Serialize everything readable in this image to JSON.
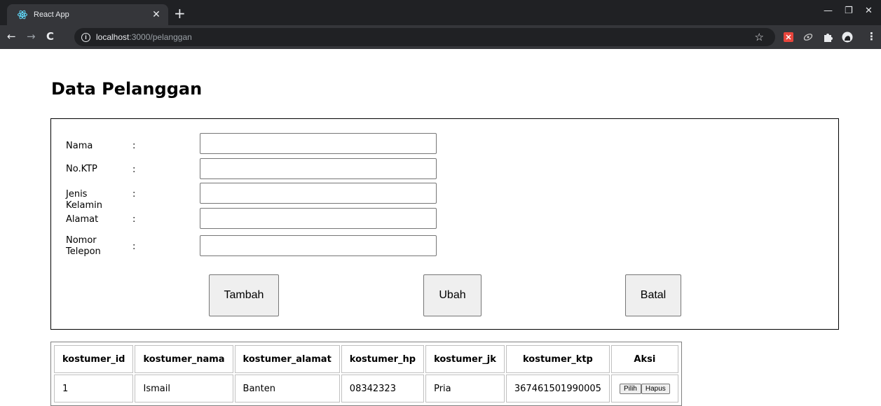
{
  "browser": {
    "tab_title": "React App",
    "url_host": "localhost",
    "url_path": ":3000/pelanggan",
    "icons": {
      "favicon": "react-icon",
      "close": "close-icon",
      "new_tab": "plus-icon",
      "back": "back-arrow-icon",
      "forward": "forward-arrow-icon",
      "reload": "reload-icon",
      "info": "info-icon",
      "bookmark": "star-icon",
      "extensions": "puzzle-icon",
      "menu": "kebab-menu-icon"
    },
    "colors": {
      "tabbar": "#202124",
      "toolbar": "#35363a"
    }
  },
  "page": {
    "title": "Data Pelanggan"
  },
  "form": {
    "fields": [
      {
        "label": "Nama",
        "colon": ":",
        "value": ""
      },
      {
        "label": "No.KTP",
        "colon": ":",
        "value": ""
      },
      {
        "label": "Jenis Kelamin",
        "colon": ":",
        "value": ""
      },
      {
        "label": "Alamat",
        "colon": ":",
        "value": ""
      },
      {
        "label": "Nomor Telepon",
        "colon": ":",
        "value": ""
      }
    ],
    "buttons": {
      "add": "Tambah",
      "edit": "Ubah",
      "cancel": "Batal"
    }
  },
  "table": {
    "headers": [
      "kostumer_id",
      "kostumer_nama",
      "kostumer_alamat",
      "kostumer_hp",
      "kostumer_jk",
      "kostumer_ktp",
      "Aksi"
    ],
    "rows": [
      {
        "id": "1",
        "nama": "Ismail",
        "alamat": "Banten",
        "hp": "08342323",
        "jk": "Pria",
        "ktp": "367461501990005",
        "select_label": "Pilih",
        "delete_label": "Hapus"
      }
    ]
  }
}
